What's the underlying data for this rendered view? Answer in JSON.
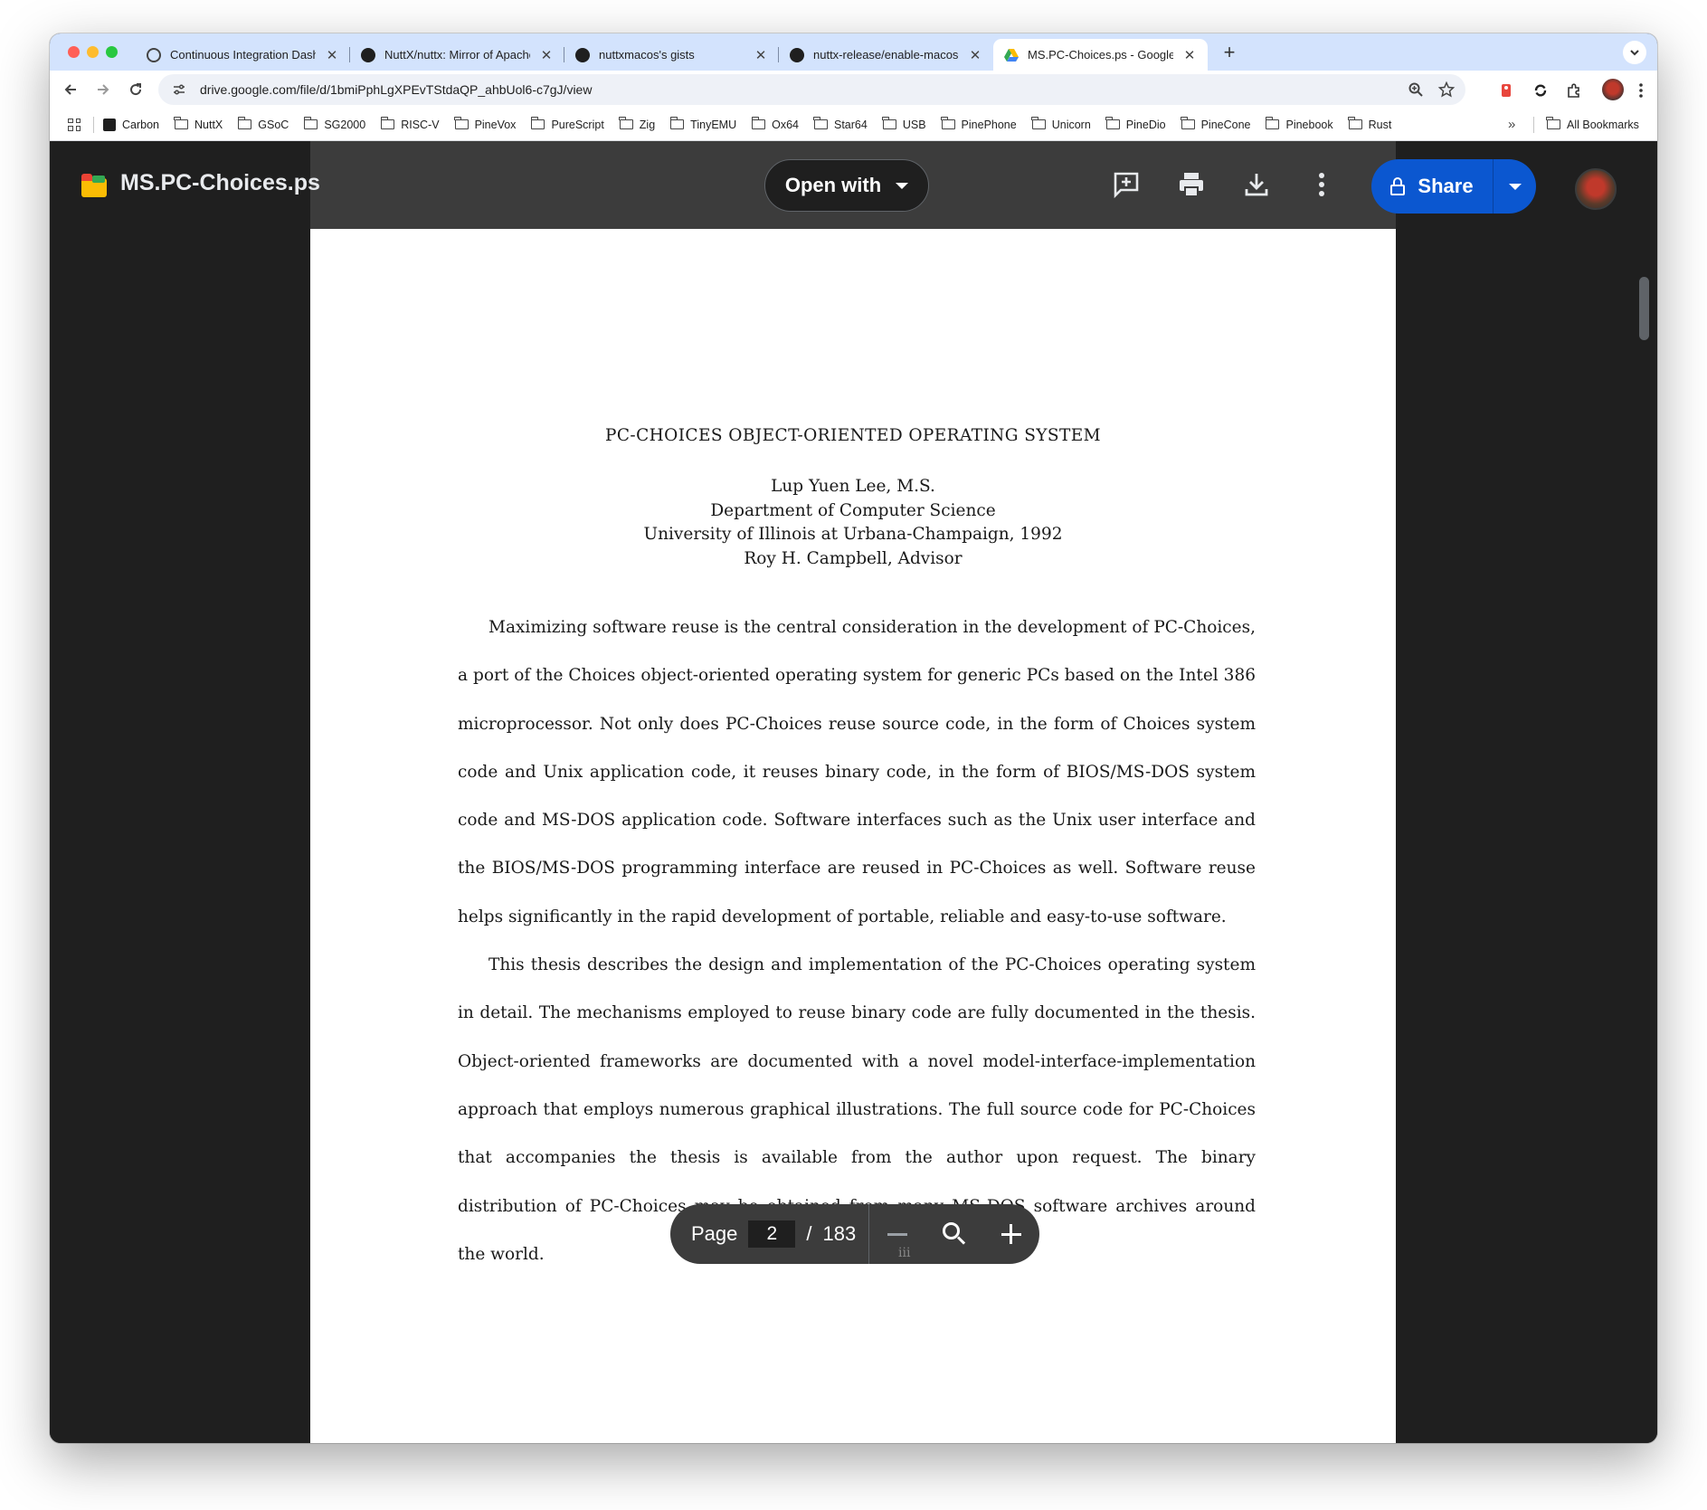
{
  "browser": {
    "tabs": [
      {
        "title": "Continuous Integration Dashb",
        "icon": "globe-icon",
        "active": false
      },
      {
        "title": "NuttX/nuttx: Mirror of Apache",
        "icon": "github-icon",
        "active": false
      },
      {
        "title": "nuttxmacos's gists",
        "icon": "github-icon",
        "active": false
      },
      {
        "title": "nuttx-release/enable-macos-",
        "icon": "github-icon",
        "active": false
      },
      {
        "title": "MS.PC-Choices.ps - Google D",
        "icon": "google-drive-icon",
        "active": true
      }
    ],
    "close_glyph": "✕",
    "new_tab_glyph": "+",
    "url": "drive.google.com/file/d/1bmiPphLgXPEvTStdaQP_ahbUol6-c7gJ/view",
    "bookmarks": [
      "Carbon",
      "NuttX",
      "GSoC",
      "SG2000",
      "RISC-V",
      "PineVox",
      "PureScript",
      "Zig",
      "TinyEMU",
      "Ox64",
      "Star64",
      "USB",
      "PinePhone",
      "Unicorn",
      "PineDio",
      "PineCone",
      "Pinebook",
      "Rust"
    ],
    "more_bookmarks": "»",
    "all_bookmarks": "All Bookmarks"
  },
  "drive": {
    "file_name": "MS.PC-Choices.ps",
    "open_with_label": "Open with",
    "share_label": "Share",
    "accent": "#0b57d0"
  },
  "document": {
    "title": "PC-CHOICES OBJECT-ORIENTED OPERATING SYSTEM",
    "author": "Lup Yuen Lee, M.S.",
    "department": "Department of Computer Science",
    "university": "University of Illinois at Urbana-Champaign, 1992",
    "advisor": "Roy H. Campbell, Advisor",
    "paragraph1": "Maximizing software reuse is the central consideration in the development of PC-Choices, a port of the Choices object-oriented operating system for generic PCs based on the Intel 386 microprocessor. Not only does PC-Choices reuse source code, in the form of Choices system code and Unix application code, it reuses binary code, in the form of BIOS/MS-DOS system code and MS-DOS application code. Software interfaces such as the Unix user interface and the BIOS/MS-DOS programming interface are reused in PC-Choices as well. Software reuse helps significantly in the rapid development of portable, reliable and easy-to-use software.",
    "paragraph2": "This thesis describes the design and implementation of the PC-Choices operating system in detail. The mechanisms employed to reuse binary code are fully documented in the the­sis. Object-oriented frameworks are documented with a novel model-interface-implementation approach that employs numerous graphical illustrations. The full source code for PC-Choices that accompanies the thesis is available from the author upon request. The binary distribution of PC-Choices may be obtained from many MS-DOS software archives around the world.",
    "page_number_roman": "iii"
  },
  "pager": {
    "label": "Page",
    "current": "2",
    "separator": "/",
    "total": "183"
  }
}
